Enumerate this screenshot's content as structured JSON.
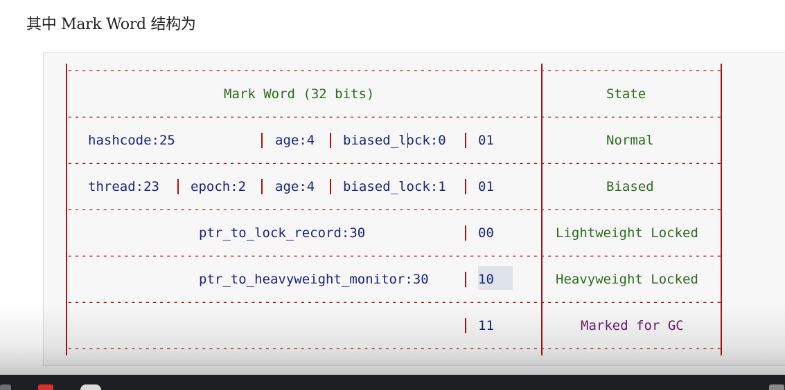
{
  "heading": "其中 Mark Word 结构为",
  "table": {
    "header": {
      "mark_word": "Mark Word (32 bits)",
      "state": "State"
    },
    "rows": [
      {
        "fields": [
          "hashcode:25",
          "age:4",
          "biased_lock:0"
        ],
        "bits": "01",
        "state": "Normal"
      },
      {
        "fields": [
          "thread:23",
          "epoch:2",
          "age:4",
          "biased_lock:1"
        ],
        "bits": "01",
        "state": "Biased"
      },
      {
        "fields": [
          "ptr_to_lock_record:30"
        ],
        "bits": "00",
        "state": "Lightweight Locked"
      },
      {
        "fields": [
          "ptr_to_heavyweight_monitor:30"
        ],
        "bits": "10",
        "state": "Heavyweight Locked"
      },
      {
        "fields": [],
        "bits": "11",
        "state": "Marked for GC"
      }
    ]
  },
  "colors": {
    "border": "#a31515",
    "field": "#1a237e",
    "state": "#2e6b1f",
    "gc_state": "#6b1a6b",
    "highlight": "#dfe4ea"
  },
  "taskbar": {
    "icons": [
      "app-icon",
      "red-app-icon",
      "panda-icon"
    ]
  }
}
